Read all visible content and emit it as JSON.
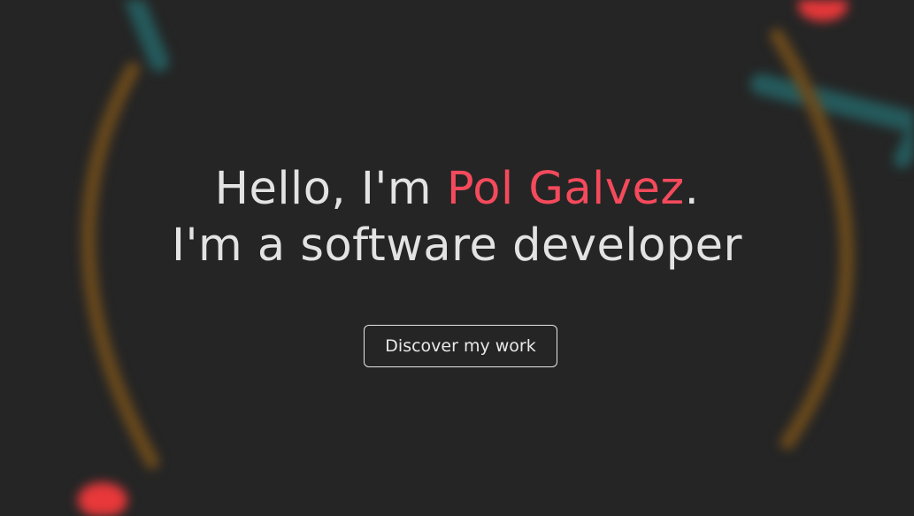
{
  "hero": {
    "greeting_prefix": "Hello, I'm ",
    "name": "Pol Galvez",
    "greeting_suffix": ".",
    "role_line": "I'm a software developer",
    "cta_label": "Discover my work"
  },
  "colors": {
    "background": "#252525",
    "text": "#e3e3e3",
    "accent": "#f44a5c",
    "arc_orange": "#6b4a1c",
    "line_teal": "#255a5c",
    "dot_red": "#e8383a"
  }
}
